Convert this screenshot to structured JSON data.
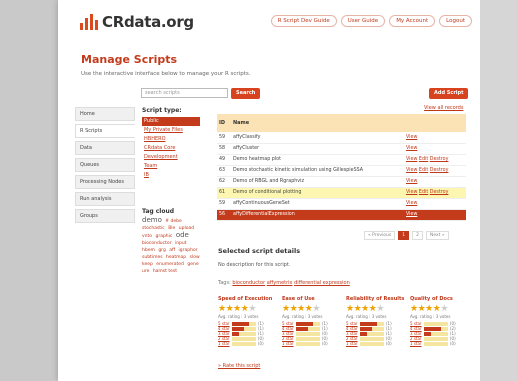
{
  "header": {
    "logo_text": "CRdata.org",
    "nav": [
      "R Script Dev Guide",
      "User Guide",
      "My Account",
      "Logout"
    ]
  },
  "page": {
    "title": "Manage Scripts",
    "subtitle": "Use the interactive interface below to manage your R scripts."
  },
  "search": {
    "placeholder": "search scripts",
    "button": "Search"
  },
  "add_button": "Add Script",
  "view_all": "View all records",
  "left_nav": [
    "Home",
    "R Scripts",
    "Data",
    "Queues",
    "Processing Nodes",
    "Run analysis",
    "Groups"
  ],
  "script_type": {
    "heading": "Script type:",
    "options": [
      "Public",
      "My Private Files",
      "HBHERO",
      "CRdata Core",
      "Development",
      "Team",
      "IB"
    ]
  },
  "tag_cloud": {
    "heading": "Tag cloud",
    "tags": [
      "demo",
      "# debe",
      "stochastic",
      "Ble",
      "upload",
      "vnto",
      "graphic",
      "ode",
      "bioconductor",
      "input",
      "hbem",
      "grg",
      "aff",
      "igraphor",
      "subtimes",
      "heatmap",
      "slow",
      "keep",
      "enumerated",
      "gene",
      "ure",
      "hamst test"
    ]
  },
  "table": {
    "columns": [
      "ID",
      "Name",
      ""
    ],
    "rows": [
      {
        "id": "59",
        "name": "affyClassify",
        "actions": [
          "View"
        ],
        "state": ""
      },
      {
        "id": "58",
        "name": "affyCluster",
        "actions": [
          "View"
        ],
        "state": ""
      },
      {
        "id": "49",
        "name": "Demo heatmap plot",
        "actions": [
          "View",
          "Edit",
          "Destroy"
        ],
        "state": ""
      },
      {
        "id": "63",
        "name": "Demo stochastic kinetic simulation using GillespieSSA",
        "actions": [
          "View",
          "Edit",
          "Destroy"
        ],
        "state": ""
      },
      {
        "id": "62",
        "name": "Demo of RBGL and Rgraphviz",
        "actions": [
          "View"
        ],
        "state": ""
      },
      {
        "id": "61",
        "name": "Demo of conditional plotting",
        "actions": [
          "View",
          "Edit",
          "Destroy"
        ],
        "state": "hl"
      },
      {
        "id": "59",
        "name": "affyContinuousGeneSet",
        "actions": [
          "View"
        ],
        "state": ""
      },
      {
        "id": "56",
        "name": "affyDifferentialExpression",
        "actions": [
          "View"
        ],
        "state": "sel"
      }
    ]
  },
  "pager": [
    "« Previous",
    "1",
    "2",
    "Next »"
  ],
  "details": {
    "title": "Selected script details",
    "description": "No description for this script.",
    "tags_label": "Tags:",
    "tags": [
      "bioconductor",
      "affymetrix",
      "differential expression"
    ]
  },
  "ratings": [
    {
      "title": "Speed of Execution",
      "stars": 4,
      "avg": "Avg. rating : 3 votes",
      "bars": [
        {
          "label": "5 star",
          "pct": 0.7,
          "count": "(1)"
        },
        {
          "label": "4 star",
          "pct": 0.5,
          "count": "(1)"
        },
        {
          "label": "3 star",
          "pct": 0.3,
          "count": "(1)"
        },
        {
          "label": "2 star",
          "pct": 0,
          "count": "(0)"
        },
        {
          "label": "1 star",
          "pct": 0,
          "count": "(0)"
        }
      ]
    },
    {
      "title": "Ease of Use",
      "stars": 4,
      "avg": "Avg. rating : 3 votes",
      "bars": [
        {
          "label": "5 star",
          "pct": 0.7,
          "count": "(1)"
        },
        {
          "label": "4 star",
          "pct": 0.5,
          "count": "(1)"
        },
        {
          "label": "3 star",
          "pct": 0,
          "count": "(0)"
        },
        {
          "label": "2 star",
          "pct": 0,
          "count": "(0)"
        },
        {
          "label": "1 star",
          "pct": 0,
          "count": "(0)"
        }
      ]
    },
    {
      "title": "Reliability of Results",
      "stars": 4,
      "avg": "Avg. rating : 3 votes",
      "bars": [
        {
          "label": "5 star",
          "pct": 0.7,
          "count": "(1)"
        },
        {
          "label": "4 star",
          "pct": 0.5,
          "count": "(1)"
        },
        {
          "label": "3 star",
          "pct": 0.3,
          "count": "(1)"
        },
        {
          "label": "2 star",
          "pct": 0,
          "count": "(0)"
        },
        {
          "label": "1 star",
          "pct": 0,
          "count": "(0)"
        }
      ]
    },
    {
      "title": "Quality of Docs",
      "stars": 4,
      "avg": "Avg. rating : 3 votes",
      "bars": [
        {
          "label": "5 star",
          "pct": 0,
          "count": "(0)"
        },
        {
          "label": "4 star",
          "pct": 0.7,
          "count": "(2)"
        },
        {
          "label": "3 star",
          "pct": 0.3,
          "count": "(1)"
        },
        {
          "label": "2 star",
          "pct": 0,
          "count": "(0)"
        },
        {
          "label": "1 star",
          "pct": 0,
          "count": "(0)"
        }
      ]
    }
  ],
  "rate_link": "» Rate this script"
}
